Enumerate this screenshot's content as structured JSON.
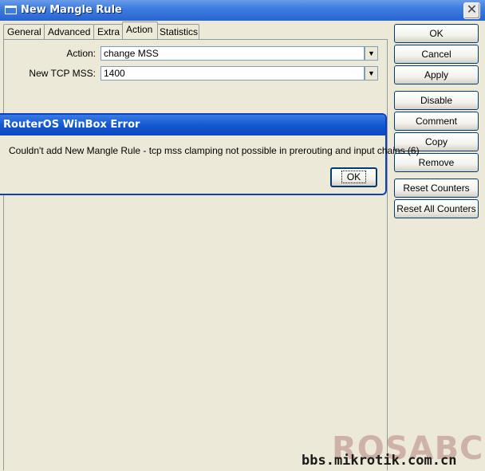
{
  "window": {
    "title": "New Mangle Rule",
    "close_glyph": "✕"
  },
  "tabs": [
    {
      "label": "General"
    },
    {
      "label": "Advanced"
    },
    {
      "label": "Extra"
    },
    {
      "label": "Action"
    },
    {
      "label": "Statistics"
    }
  ],
  "form": {
    "action_label": "Action:",
    "action_value": "change MSS",
    "mss_label": "New TCP MSS:",
    "mss_value": "1400",
    "dropdown_glyph": "▼"
  },
  "buttons": {
    "ok": "OK",
    "cancel": "Cancel",
    "apply": "Apply",
    "disable": "Disable",
    "comment": "Comment",
    "copy": "Copy",
    "remove": "Remove",
    "reset_counters": "Reset Counters",
    "reset_all_counters": "Reset All Counters"
  },
  "error_dialog": {
    "title": "RouterOS WinBox Error",
    "message": "Couldn't add New Mangle Rule - tcp mss clamping not possible in prerouting and input chains (6)",
    "ok_label": "OK"
  },
  "watermark": {
    "brand": "ROSABC",
    "site": "bbs.mikrotik.com.cn"
  },
  "colors": {
    "titlebar": "#2a64d0",
    "window_bg": "#ece9d8",
    "button_border": "#003c74"
  }
}
